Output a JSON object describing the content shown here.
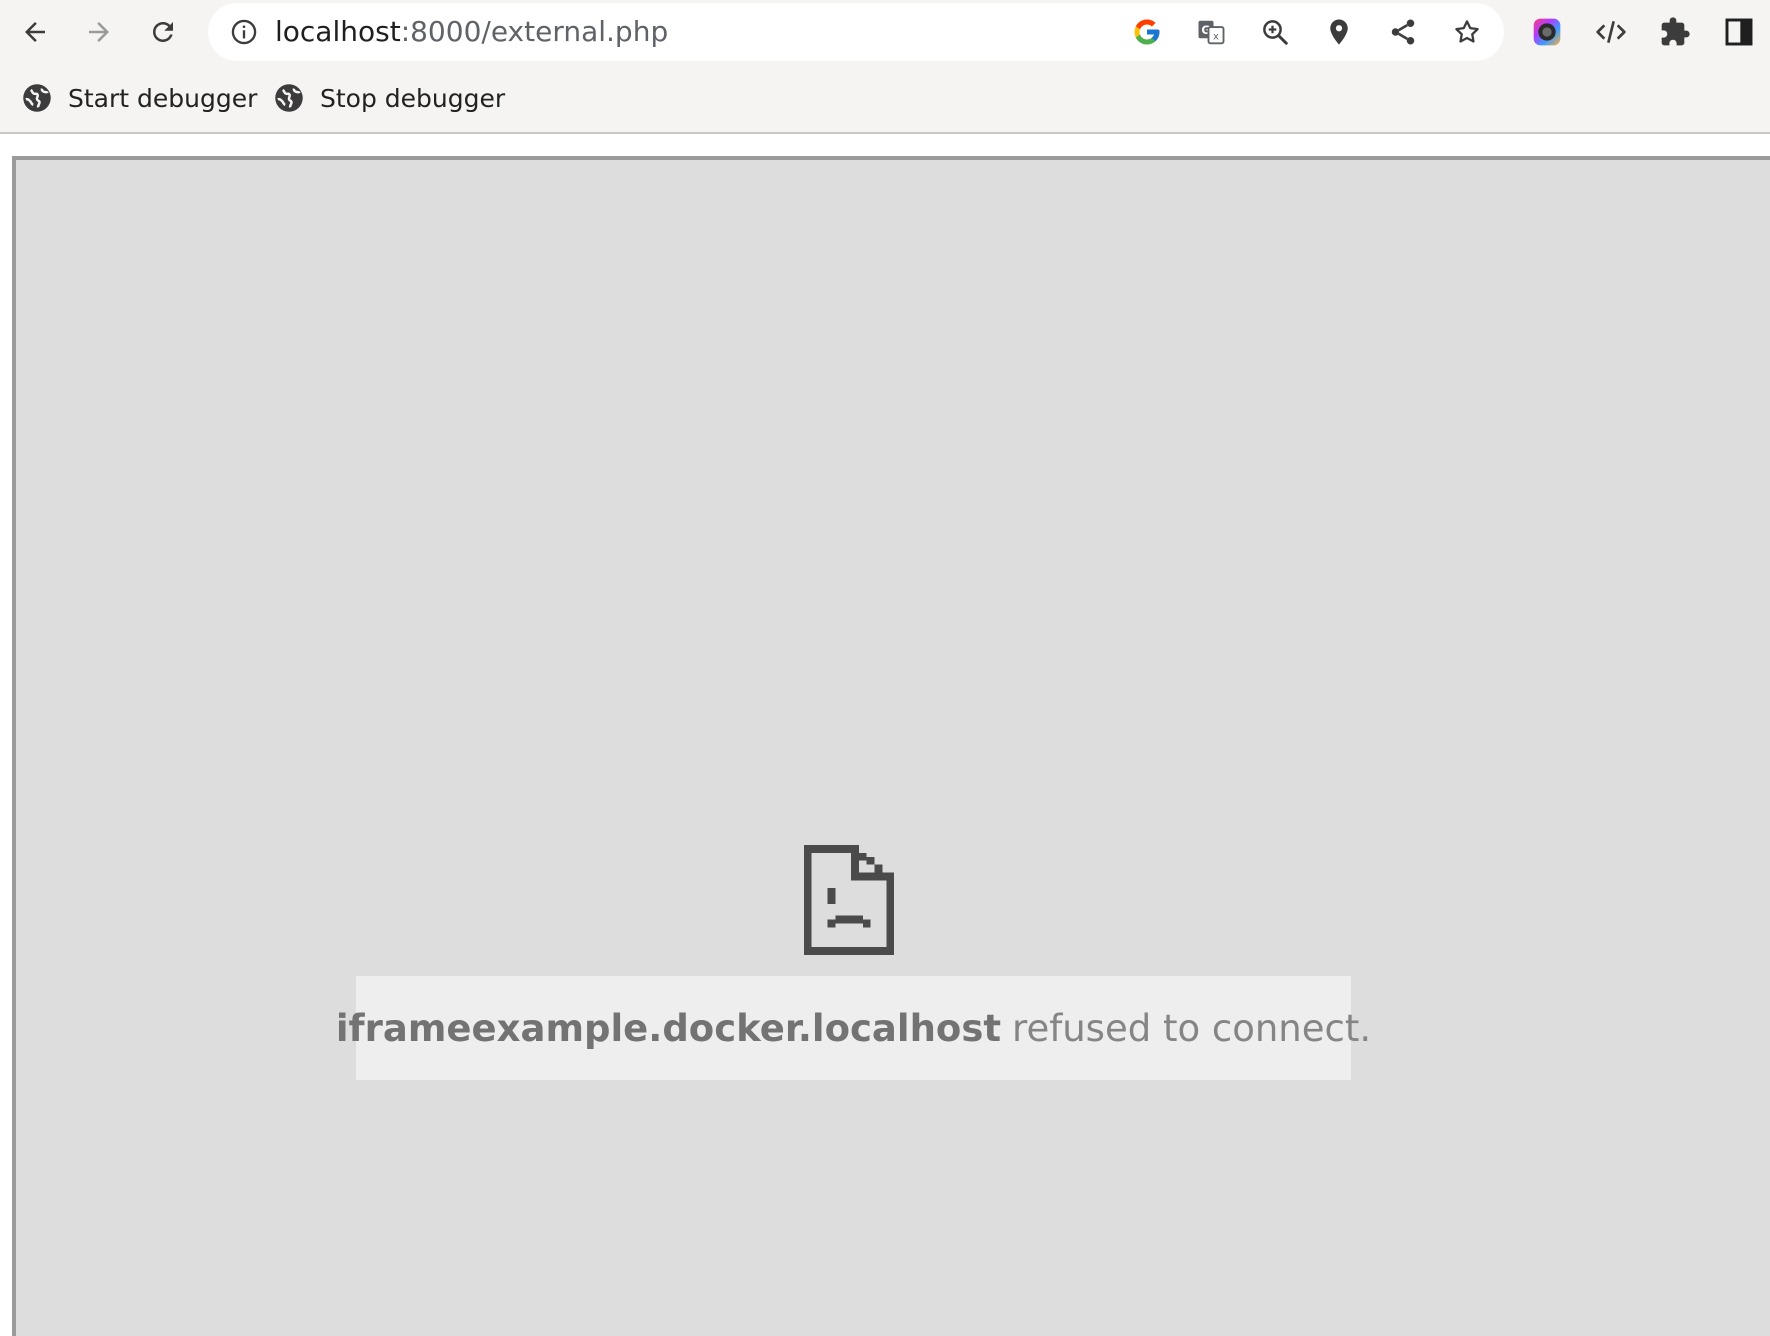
{
  "browser": {
    "url_host": "localhost",
    "url_path": ":8000/external.php",
    "nav": {
      "back_icon": "arrow-back-icon",
      "forward_icon": "arrow-forward-icon",
      "reload_icon": "reload-icon"
    },
    "omnibox_icons": [
      "google-icon",
      "translate-icon",
      "zoom-icon",
      "location-icon",
      "share-icon",
      "bookmark-star-icon"
    ],
    "extension_icons": [
      "color-picker-extension-icon",
      "code-extension-icon",
      "extensions-puzzle-icon",
      "side-panel-icon"
    ]
  },
  "bookmarks": [
    {
      "label": "Start debugger",
      "icon": "globe-icon"
    },
    {
      "label": "Stop debugger",
      "icon": "globe-icon"
    }
  ],
  "iframe_error": {
    "icon": "sad-page-icon",
    "host": "iframeexample.docker.localhost",
    "message": "refused to connect."
  },
  "colors": {
    "toolbar_bg": "#f5f4f2",
    "iframe_bg": "#dddddd",
    "error_box_bg": "#eeeeee"
  }
}
